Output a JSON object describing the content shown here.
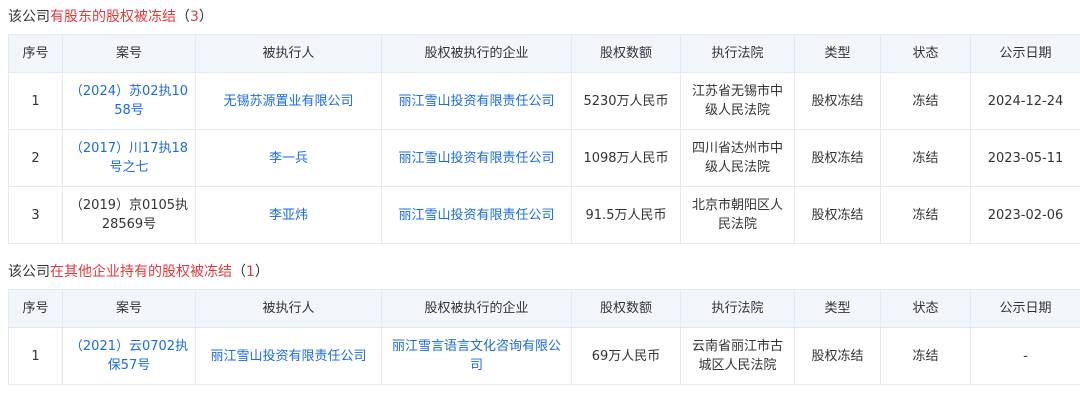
{
  "section1": {
    "prefix": "该公司",
    "highlight": "有股东的股权被冻结",
    "count_open": "（",
    "count": "3",
    "count_close": "）"
  },
  "section2": {
    "prefix": "该公司",
    "highlight": "在其他企业持有的股权被冻结",
    "count_open": "（",
    "count": "1",
    "count_close": "）"
  },
  "columns": [
    "序号",
    "案号",
    "被执行人",
    "股权被执行的企业",
    "股权数额",
    "执行法院",
    "类型",
    "状态",
    "公示日期"
  ],
  "table1": {
    "rows": [
      {
        "no": "1",
        "case_line1": "（2024）苏02执10",
        "case_line2": "58号",
        "executed": "无锡苏源置业有限公司",
        "company": "丽江雪山投资有限责任公司",
        "amount": "5230万人民币",
        "court_line1": "江苏省无锡市中",
        "court_line2": "级人民法院",
        "type": "股权冻结",
        "status": "冻结",
        "date": "2024-12-24"
      },
      {
        "no": "2",
        "case_line1": "（2017）川17执18",
        "case_line2": "号之七",
        "executed": "李一兵",
        "company": "丽江雪山投资有限责任公司",
        "amount": "1098万人民币",
        "court_line1": "四川省达州市中",
        "court_line2": "级人民法院",
        "type": "股权冻结",
        "status": "冻结",
        "date": "2023-05-11"
      },
      {
        "no": "3",
        "case_line1": "（2019）京0105执",
        "case_line2": "28569号",
        "executed": "李亚炜",
        "company": "丽江雪山投资有限责任公司",
        "amount": "91.5万人民币",
        "court_line1": "北京市朝阳区人",
        "court_line2": "民法院",
        "type": "股权冻结",
        "status": "冻结",
        "date": "2023-02-06"
      }
    ]
  },
  "table2": {
    "rows": [
      {
        "no": "1",
        "case_line1": "（2021）云0702执",
        "case_line2": "保57号",
        "executed": "丽江雪山投资有限责任公司",
        "company_line1": "丽江雪言语言文化咨询有限公",
        "company_line2": "司",
        "amount": "69万人民币",
        "court_line1": "云南省丽江市古",
        "court_line2": "城区人民法院",
        "type": "股权冻结",
        "status": "冻结",
        "date": "-"
      }
    ]
  },
  "colors": {
    "link": "#1a6ce0",
    "highlight": "#e4393c",
    "header_bg": "#f2f6fb",
    "border": "#e4eaf1"
  }
}
